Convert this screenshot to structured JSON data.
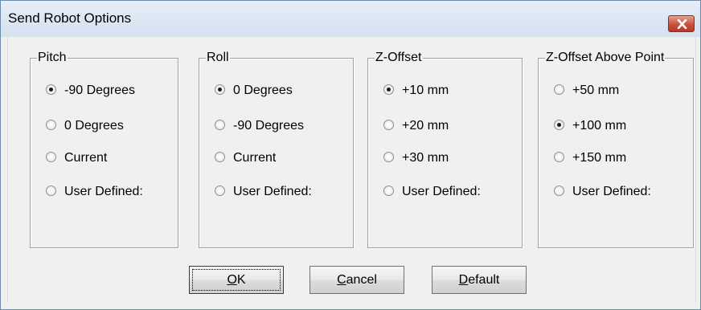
{
  "window": {
    "title": "Send Robot Options"
  },
  "groups": [
    {
      "label": "Pitch",
      "options": [
        {
          "label": "-90 Degrees",
          "selected": true
        },
        {
          "label": "0 Degrees",
          "selected": false
        },
        {
          "label": "Current",
          "selected": false
        },
        {
          "label": "User Defined:",
          "selected": false
        }
      ]
    },
    {
      "label": "Roll",
      "options": [
        {
          "label": "0 Degrees",
          "selected": true
        },
        {
          "label": "-90 Degrees",
          "selected": false
        },
        {
          "label": "Current",
          "selected": false
        },
        {
          "label": "User Defined:",
          "selected": false
        }
      ]
    },
    {
      "label": "Z-Offset",
      "options": [
        {
          "label": "+10 mm",
          "selected": true
        },
        {
          "label": "+20 mm",
          "selected": false
        },
        {
          "label": "+30 mm",
          "selected": false
        },
        {
          "label": "User Defined:",
          "selected": false
        }
      ]
    },
    {
      "label": "Z-Offset Above Point",
      "options": [
        {
          "label": "+50 mm",
          "selected": false
        },
        {
          "label": "+100 mm",
          "selected": true
        },
        {
          "label": "+150 mm",
          "selected": false
        },
        {
          "label": "User Defined:",
          "selected": false
        }
      ]
    }
  ],
  "buttons": {
    "ok": {
      "mnemonic": "O",
      "rest": "K"
    },
    "cancel": {
      "mnemonic": "C",
      "rest": "ancel"
    },
    "default": {
      "mnemonic": "D",
      "rest": "efault"
    }
  },
  "icons": {
    "close": "close-icon"
  }
}
